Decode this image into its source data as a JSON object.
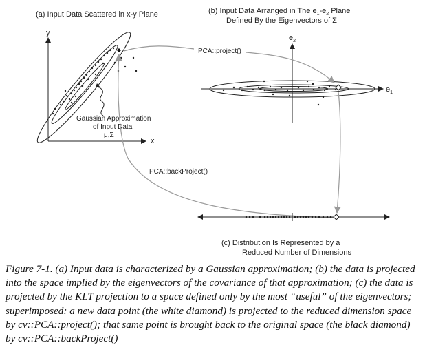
{
  "panel_a": {
    "title": "(a) Input Data Scattered in x-y Plane",
    "y_axis_label": "y",
    "x_axis_label": "x",
    "gaussian_label_line1": "Gaussian Approximation",
    "gaussian_label_line2": "of Input Data",
    "gaussian_label_line3": "μ,Σ"
  },
  "panel_b": {
    "title_line1_pre": "(b) Input Data Arranged in The e",
    "title_sub1": "1",
    "title_mid": "-e",
    "title_sub2": "2",
    "title_post": " Plane",
    "title_line2": "Defined By the Eigenvectors of Σ",
    "e2_label": "e",
    "e2_sub": "2",
    "e1_label": "e",
    "e1_sub": "1"
  },
  "arrows": {
    "project_label": "PCA::project()",
    "backproject_label": "PCA::backProject()"
  },
  "panel_c": {
    "title_line1": "(c) Distribution Is Represented by a",
    "title_line2": "Reduced Number of Dimensions"
  },
  "caption": {
    "label": "Figure 7-1. ",
    "text": "(a) Input data is characterized by a Gaussian approximation; (b) the data is projected into the space implied by the eigenvectors of the covariance of that approxi­mation; (c) the data is projected by the KLT projection to a space defined only by the most “useful” of the eigenvectors; superimposed: a new data point (the white diamond) is projected to the reduced dimension space by cv::PCA::project(); that same point is brought back to the original space (the black diamond) by cv::PCA::backProject()"
  },
  "colors": {
    "ink": "#222222",
    "arrow_gray": "#9a9a9a"
  }
}
